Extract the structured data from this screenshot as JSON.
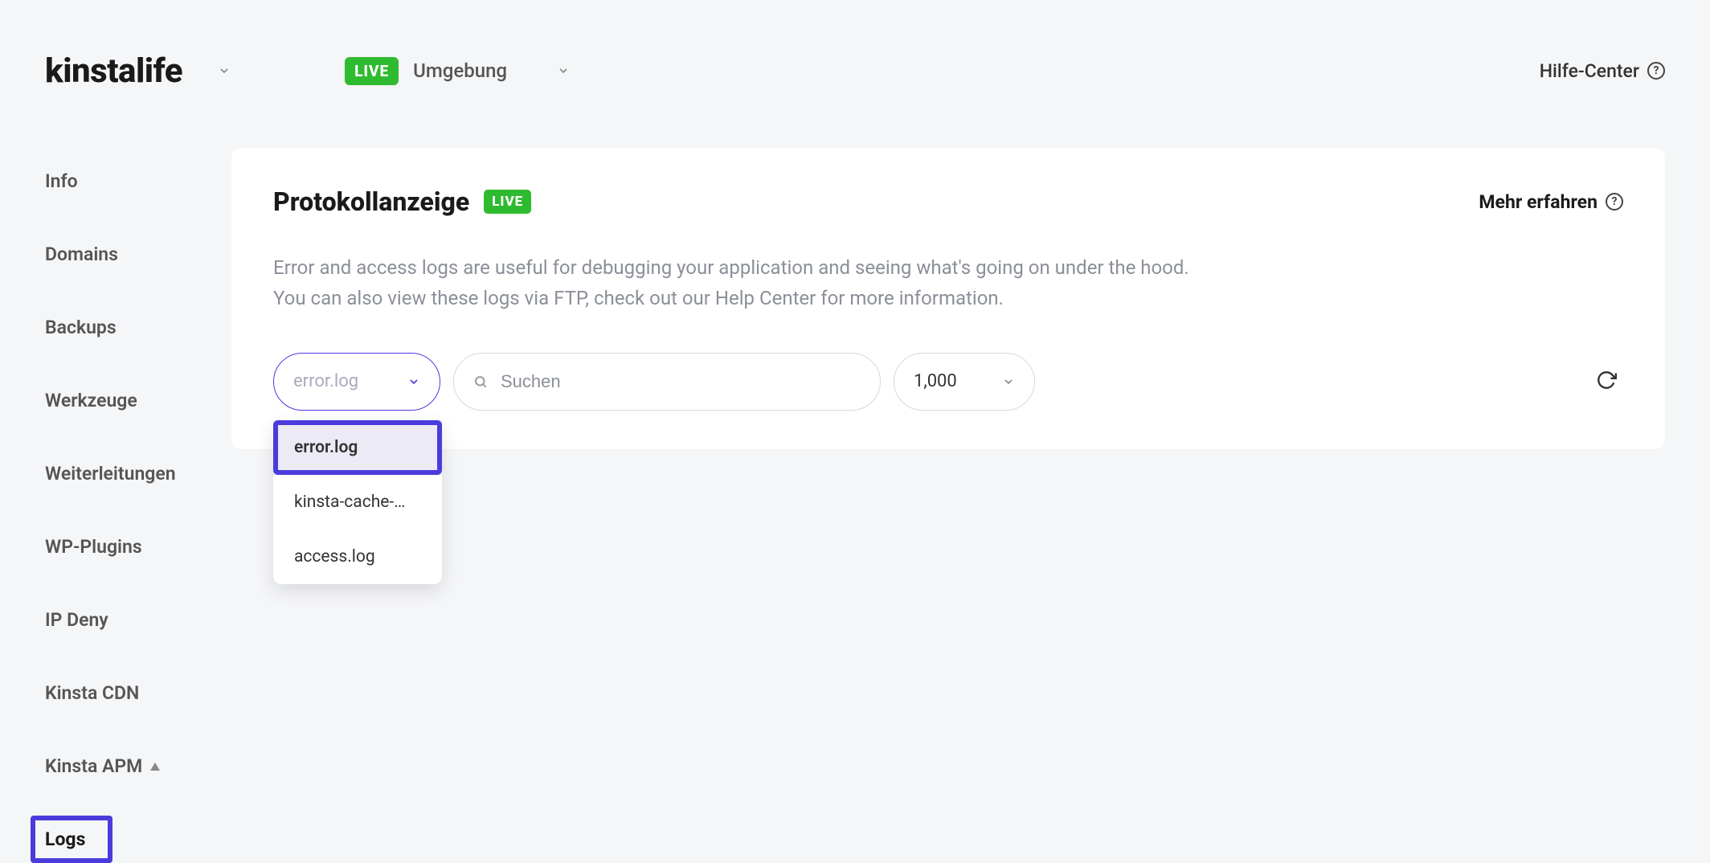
{
  "header": {
    "site_name": "kinstalife",
    "live_badge": "LIVE",
    "environment_label": "Umgebung",
    "help_center": "Hilfe-Center"
  },
  "sidebar": {
    "items": [
      {
        "label": "Info"
      },
      {
        "label": "Domains"
      },
      {
        "label": "Backups"
      },
      {
        "label": "Werkzeuge"
      },
      {
        "label": "Weiterleitungen"
      },
      {
        "label": "WP-Plugins"
      },
      {
        "label": "IP Deny"
      },
      {
        "label": "Kinsta CDN"
      },
      {
        "label": "Kinsta APM"
      },
      {
        "label": "Logs"
      }
    ]
  },
  "main": {
    "title": "Protokollanzeige",
    "live_badge": "LIVE",
    "learn_more": "Mehr erfahren",
    "description": "Error and access logs are useful for debugging your application and seeing what's going on under the hood. You can also view these logs via FTP, check out our Help Center for more information.",
    "controls": {
      "log_select": {
        "value": "error.log",
        "options": [
          "error.log",
          "kinsta-cache-…",
          "access.log"
        ]
      },
      "search_placeholder": "Suchen",
      "count_value": "1,000"
    }
  },
  "colors": {
    "accent": "#4a3cdc",
    "live_green": "#2fbb2f"
  }
}
